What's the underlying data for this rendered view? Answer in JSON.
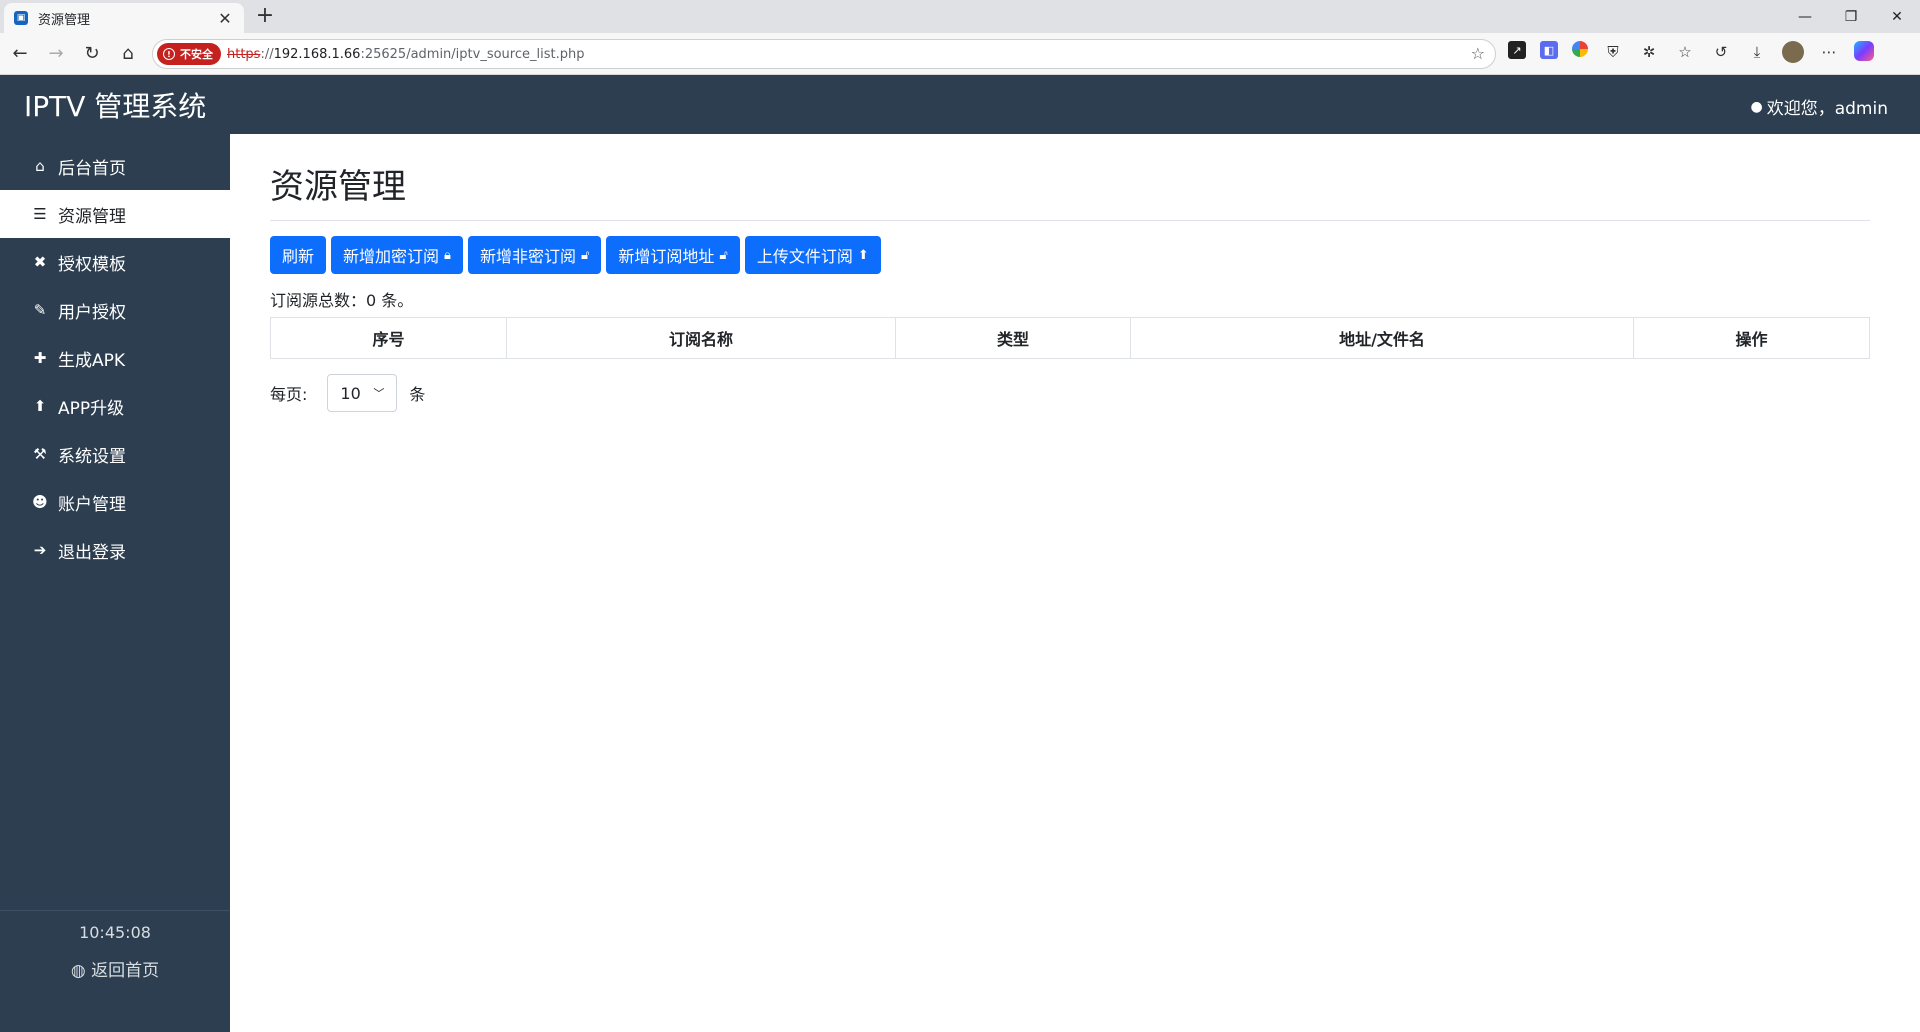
{
  "browser": {
    "tab_title": "资源管理",
    "tab_close": "✕",
    "new_tab": "+",
    "security_label": "不安全",
    "url_scheme": "https",
    "url_sep": "://",
    "url_host": "192.168.1.66",
    "url_path": ":25625/admin/iptv_source_list.php"
  },
  "app": {
    "brand": "IPTV 管理系统",
    "welcome": "欢迎您，admin"
  },
  "sidebar": {
    "items": [
      {
        "label": "后台首页",
        "icon": "home-icon",
        "active": false
      },
      {
        "label": "资源管理",
        "icon": "rss-icon",
        "active": true
      },
      {
        "label": "授权模板",
        "icon": "tools-icon",
        "active": false
      },
      {
        "label": "用户授权",
        "icon": "feather-icon",
        "active": false
      },
      {
        "label": "生成APK",
        "icon": "puzzle-icon",
        "active": false
      },
      {
        "label": "APP升级",
        "icon": "arrow-up-circle-icon",
        "active": false
      },
      {
        "label": "系统设置",
        "icon": "wrench-icon",
        "active": false
      },
      {
        "label": "账户管理",
        "icon": "users-icon",
        "active": false
      },
      {
        "label": "退出登录",
        "icon": "sign-out-icon",
        "active": false
      }
    ],
    "clock": "10:45:08",
    "back_home": "返回首页"
  },
  "main": {
    "title": "资源管理",
    "buttons": {
      "refresh": "刷新",
      "add_encrypted": "新增加密订阅",
      "add_plain": "新增非密订阅",
      "add_url": "新增订阅地址",
      "upload_file": "上传文件订阅"
    },
    "count_text": "订阅源总数：0 条。",
    "table": {
      "headers": [
        "序号",
        "订阅名称",
        "类型",
        "地址/文件名",
        "操作"
      ]
    },
    "pager": {
      "per_page_label": "每页:",
      "value": "10",
      "unit": "条"
    }
  },
  "colors": {
    "sidebar_bg": "#2c3e50",
    "primary": "#0d6efd"
  }
}
